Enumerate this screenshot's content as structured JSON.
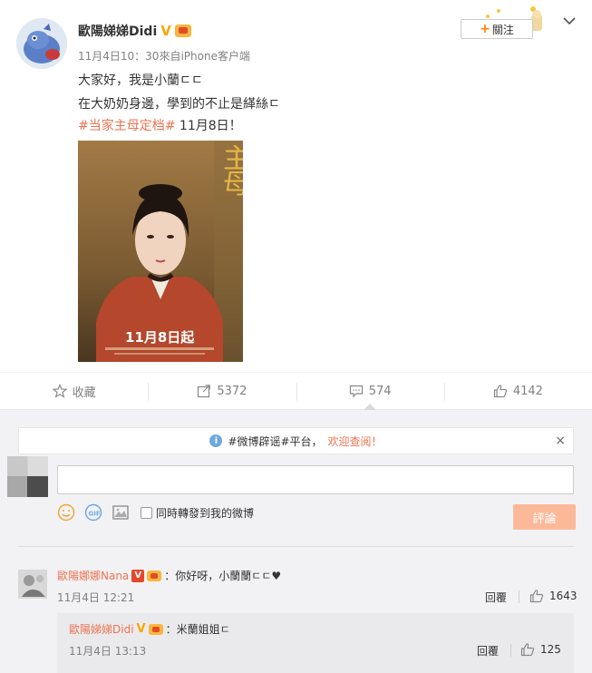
{
  "post": {
    "author": "歐陽娣娣Didi",
    "verified_badge": "V",
    "meta": "11月4日10：30來自iPhone客户端",
    "follow_label": "關注",
    "lines": [
      "大家好，我是小蘭ㄷㄷ",
      "在大奶奶身邊，學到的不止是緙絲ㄷ"
    ],
    "hashtag": "#当家主母定档#",
    "date_text": " 11月8日！",
    "poster_text": "11月8日起"
  },
  "actions": {
    "favorite_label": "收藏",
    "repost_count": "5372",
    "comment_count": "574",
    "like_count": "4142"
  },
  "notice": {
    "text_main": "#微博辟谣#平台，",
    "text_highlight": "欢迎查阅！",
    "close": "×"
  },
  "composer": {
    "input_value": "",
    "also_repost_label": "同時轉發到我的微博",
    "submit_label": "評論"
  },
  "comments": [
    {
      "author": "歐陽娜娜Nana",
      "text": "：你好呀，小蘭蘭ㄷㄷ♥",
      "time": "11月4日 12:21",
      "reply_label": "回覆",
      "likes": "1643"
    }
  ],
  "replies": [
    {
      "author": "歐陽娣娣Didi",
      "text": "：米蘭姐姐ㄷ",
      "time": "11月4日 13:13",
      "reply_label": "回覆",
      "likes": "125"
    }
  ],
  "colors": {
    "accent": "#eb7350",
    "orange": "#ff8200",
    "submit_disabled": "#fbb99a"
  }
}
